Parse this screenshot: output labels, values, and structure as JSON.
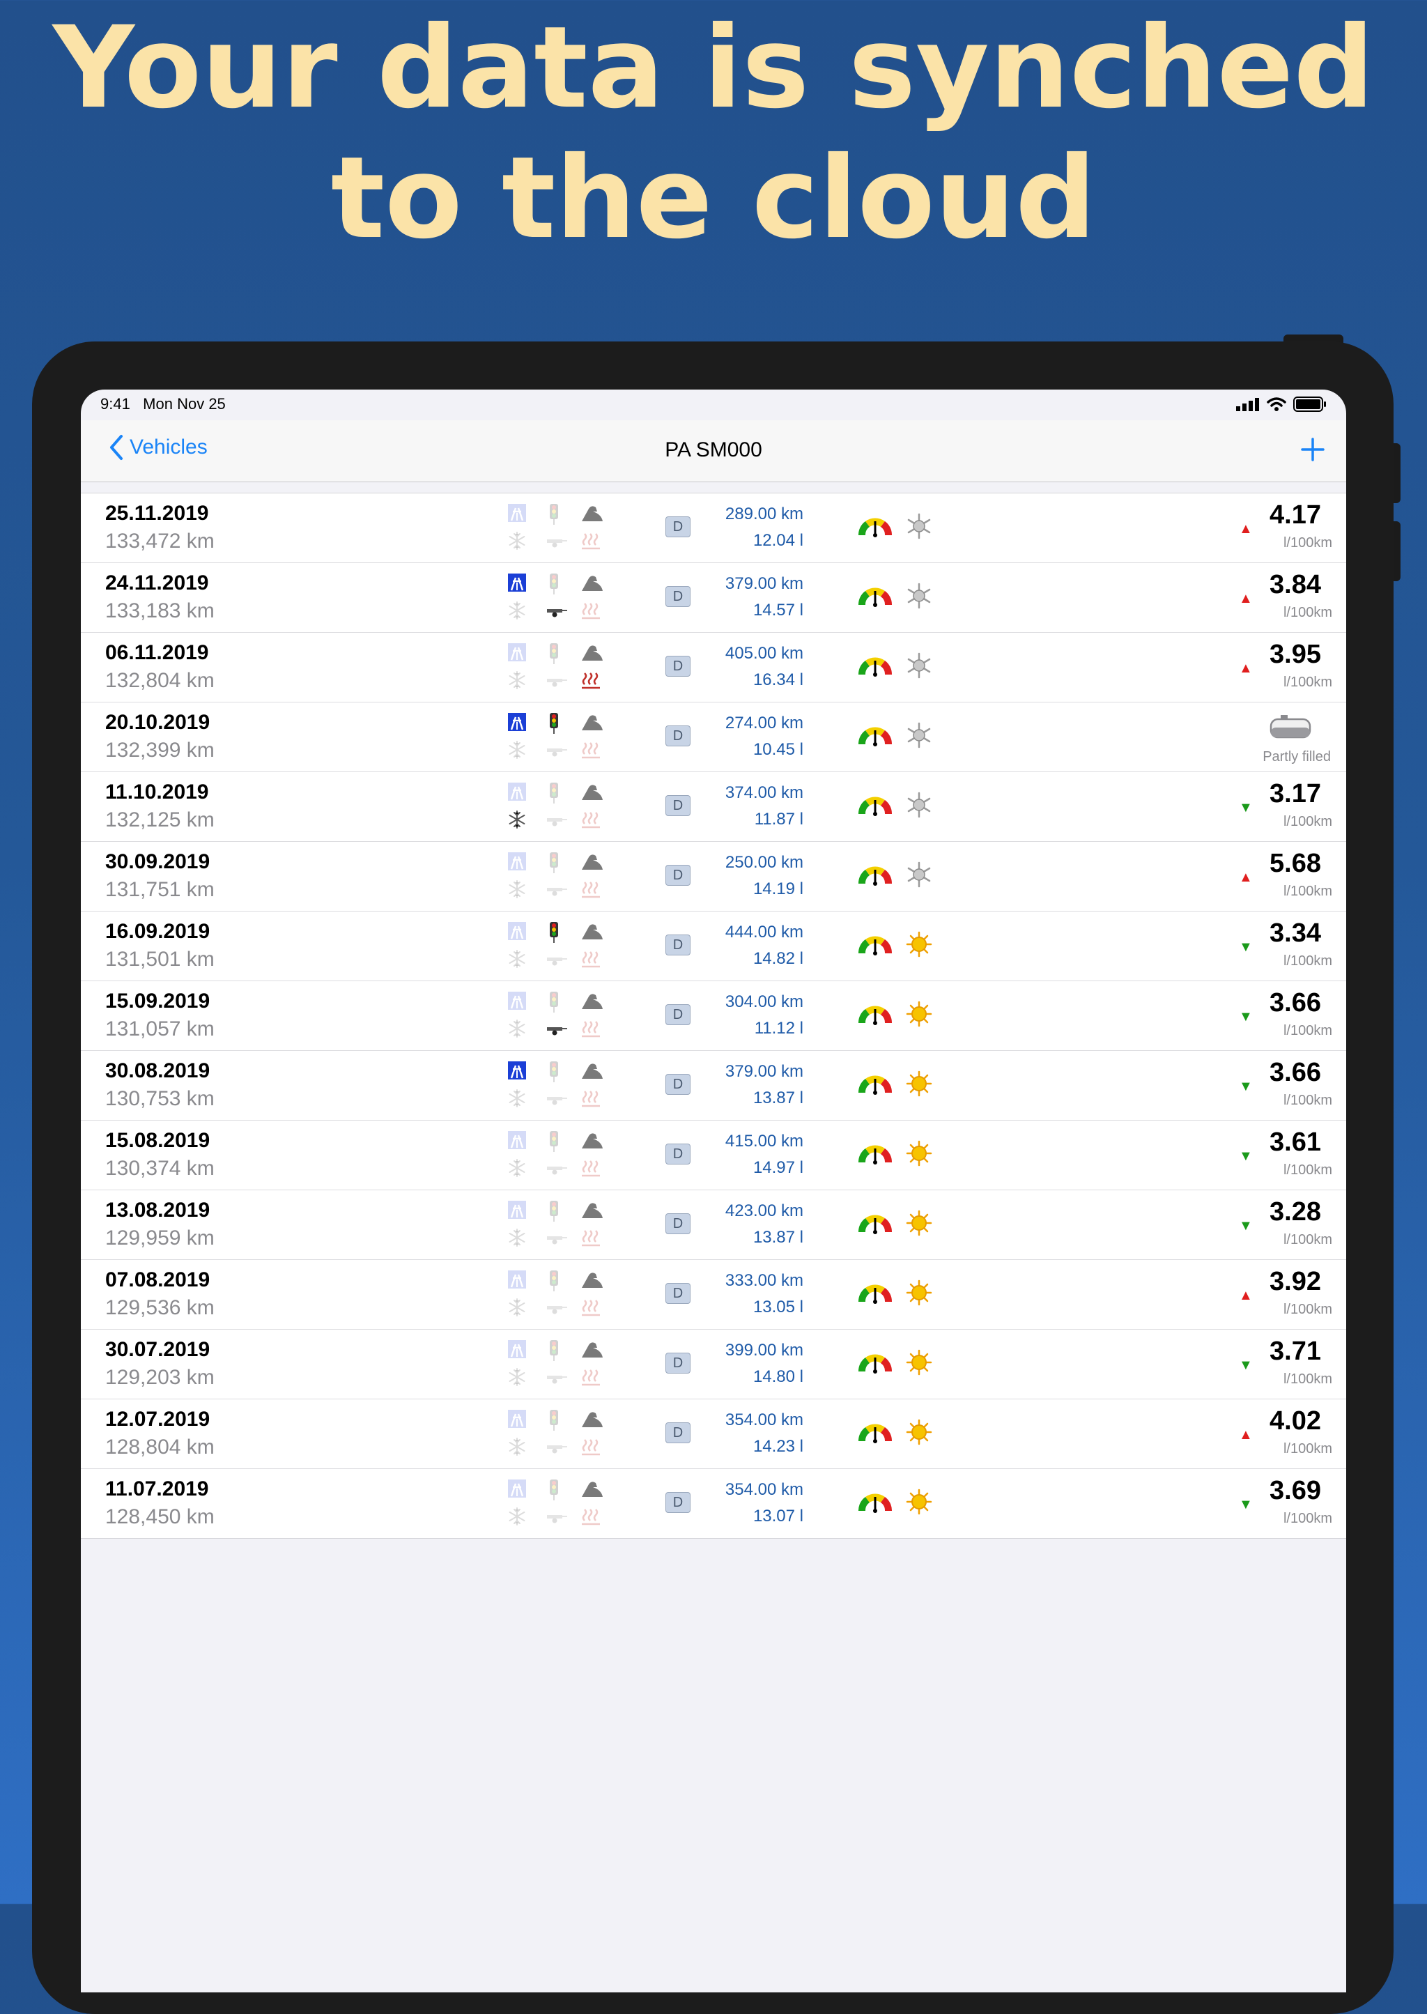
{
  "headline": {
    "line1": "Your data is synched",
    "line2": "to the cloud"
  },
  "status": {
    "time": "9:41",
    "date": "Mon Nov 25"
  },
  "nav": {
    "back_label": "Vehicles",
    "title": "PA SM000",
    "add_icon": "plus-icon"
  },
  "colors": {
    "accent": "#1a84f7",
    "up": "#e01e1e",
    "down": "#1b9a1b",
    "distance": "#1f5ba8",
    "headline": "#fbe3a8"
  },
  "entries": [
    {
      "date": "25.11.2019",
      "odometer": "133,472 km",
      "fuel": "D",
      "distance": "289.00 km",
      "volume": "12.04 l",
      "trend": "up",
      "trend_symbol": "▲",
      "consumption": "4.17",
      "unit": "l/100km",
      "weather": "cold",
      "motorway": false,
      "city": false,
      "snow": false,
      "trailer": false,
      "heater": false,
      "partly": false
    },
    {
      "date": "24.11.2019",
      "odometer": "133,183 km",
      "fuel": "D",
      "distance": "379.00 km",
      "volume": "14.57 l",
      "trend": "up",
      "trend_symbol": "▲",
      "consumption": "3.84",
      "unit": "l/100km",
      "weather": "cold",
      "motorway": true,
      "city": false,
      "snow": false,
      "trailer": true,
      "heater": false,
      "partly": false
    },
    {
      "date": "06.11.2019",
      "odometer": "132,804 km",
      "fuel": "D",
      "distance": "405.00 km",
      "volume": "16.34 l",
      "trend": "up",
      "trend_symbol": "▲",
      "consumption": "3.95",
      "unit": "l/100km",
      "weather": "cold",
      "motorway": false,
      "city": false,
      "snow": false,
      "trailer": false,
      "heater": true,
      "partly": false
    },
    {
      "date": "20.10.2019",
      "odometer": "132,399 km",
      "fuel": "D",
      "distance": "274.00 km",
      "volume": "10.45 l",
      "trend": "none",
      "trend_symbol": "",
      "consumption": "",
      "unit": "",
      "weather": "cold",
      "motorway": true,
      "city": true,
      "snow": false,
      "trailer": false,
      "heater": false,
      "partly": true,
      "partly_label": "Partly filled"
    },
    {
      "date": "11.10.2019",
      "odometer": "132,125 km",
      "fuel": "D",
      "distance": "374.00 km",
      "volume": "11.87 l",
      "trend": "down",
      "trend_symbol": "▼",
      "consumption": "3.17",
      "unit": "l/100km",
      "weather": "cold",
      "motorway": false,
      "city": false,
      "snow": true,
      "trailer": false,
      "heater": false,
      "partly": false
    },
    {
      "date": "30.09.2019",
      "odometer": "131,751 km",
      "fuel": "D",
      "distance": "250.00 km",
      "volume": "14.19 l",
      "trend": "up",
      "trend_symbol": "▲",
      "consumption": "5.68",
      "unit": "l/100km",
      "weather": "cold",
      "motorway": false,
      "city": false,
      "snow": false,
      "trailer": false,
      "heater": false,
      "partly": false
    },
    {
      "date": "16.09.2019",
      "odometer": "131,501 km",
      "fuel": "D",
      "distance": "444.00 km",
      "volume": "14.82 l",
      "trend": "down",
      "trend_symbol": "▼",
      "consumption": "3.34",
      "unit": "l/100km",
      "weather": "sun",
      "motorway": false,
      "city": true,
      "snow": false,
      "trailer": false,
      "heater": false,
      "partly": false
    },
    {
      "date": "15.09.2019",
      "odometer": "131,057 km",
      "fuel": "D",
      "distance": "304.00 km",
      "volume": "11.12 l",
      "trend": "down",
      "trend_symbol": "▼",
      "consumption": "3.66",
      "unit": "l/100km",
      "weather": "sun",
      "motorway": false,
      "city": false,
      "snow": false,
      "trailer": true,
      "heater": false,
      "partly": false
    },
    {
      "date": "30.08.2019",
      "odometer": "130,753 km",
      "fuel": "D",
      "distance": "379.00 km",
      "volume": "13.87 l",
      "trend": "down",
      "trend_symbol": "▼",
      "consumption": "3.66",
      "unit": "l/100km",
      "weather": "sun",
      "motorway": true,
      "city": false,
      "snow": false,
      "trailer": false,
      "heater": false,
      "partly": false
    },
    {
      "date": "15.08.2019",
      "odometer": "130,374 km",
      "fuel": "D",
      "distance": "415.00 km",
      "volume": "14.97 l",
      "trend": "down",
      "trend_symbol": "▼",
      "consumption": "3.61",
      "unit": "l/100km",
      "weather": "sun",
      "motorway": false,
      "city": false,
      "snow": false,
      "trailer": false,
      "heater": false,
      "partly": false
    },
    {
      "date": "13.08.2019",
      "odometer": "129,959 km",
      "fuel": "D",
      "distance": "423.00 km",
      "volume": "13.87 l",
      "trend": "down",
      "trend_symbol": "▼",
      "consumption": "3.28",
      "unit": "l/100km",
      "weather": "sun",
      "motorway": false,
      "city": false,
      "snow": false,
      "trailer": false,
      "heater": false,
      "partly": false
    },
    {
      "date": "07.08.2019",
      "odometer": "129,536 km",
      "fuel": "D",
      "distance": "333.00 km",
      "volume": "13.05 l",
      "trend": "up",
      "trend_symbol": "▲",
      "consumption": "3.92",
      "unit": "l/100km",
      "weather": "sun",
      "motorway": false,
      "city": false,
      "snow": false,
      "trailer": false,
      "heater": false,
      "partly": false
    },
    {
      "date": "30.07.2019",
      "odometer": "129,203 km",
      "fuel": "D",
      "distance": "399.00 km",
      "volume": "14.80 l",
      "trend": "down",
      "trend_symbol": "▼",
      "consumption": "3.71",
      "unit": "l/100km",
      "weather": "sun",
      "motorway": false,
      "city": false,
      "snow": false,
      "trailer": false,
      "heater": false,
      "partly": false
    },
    {
      "date": "12.07.2019",
      "odometer": "128,804 km",
      "fuel": "D",
      "distance": "354.00 km",
      "volume": "14.23 l",
      "trend": "up",
      "trend_symbol": "▲",
      "consumption": "4.02",
      "unit": "l/100km",
      "weather": "sun",
      "motorway": false,
      "city": false,
      "snow": false,
      "trailer": false,
      "heater": false,
      "partly": false
    },
    {
      "date": "11.07.2019",
      "odometer": "128,450 km",
      "fuel": "D",
      "distance": "354.00 km",
      "volume": "13.07 l",
      "trend": "down",
      "trend_symbol": "▼",
      "consumption": "3.69",
      "unit": "l/100km",
      "weather": "sun",
      "motorway": false,
      "city": false,
      "snow": false,
      "trailer": false,
      "heater": false,
      "partly": false
    }
  ]
}
